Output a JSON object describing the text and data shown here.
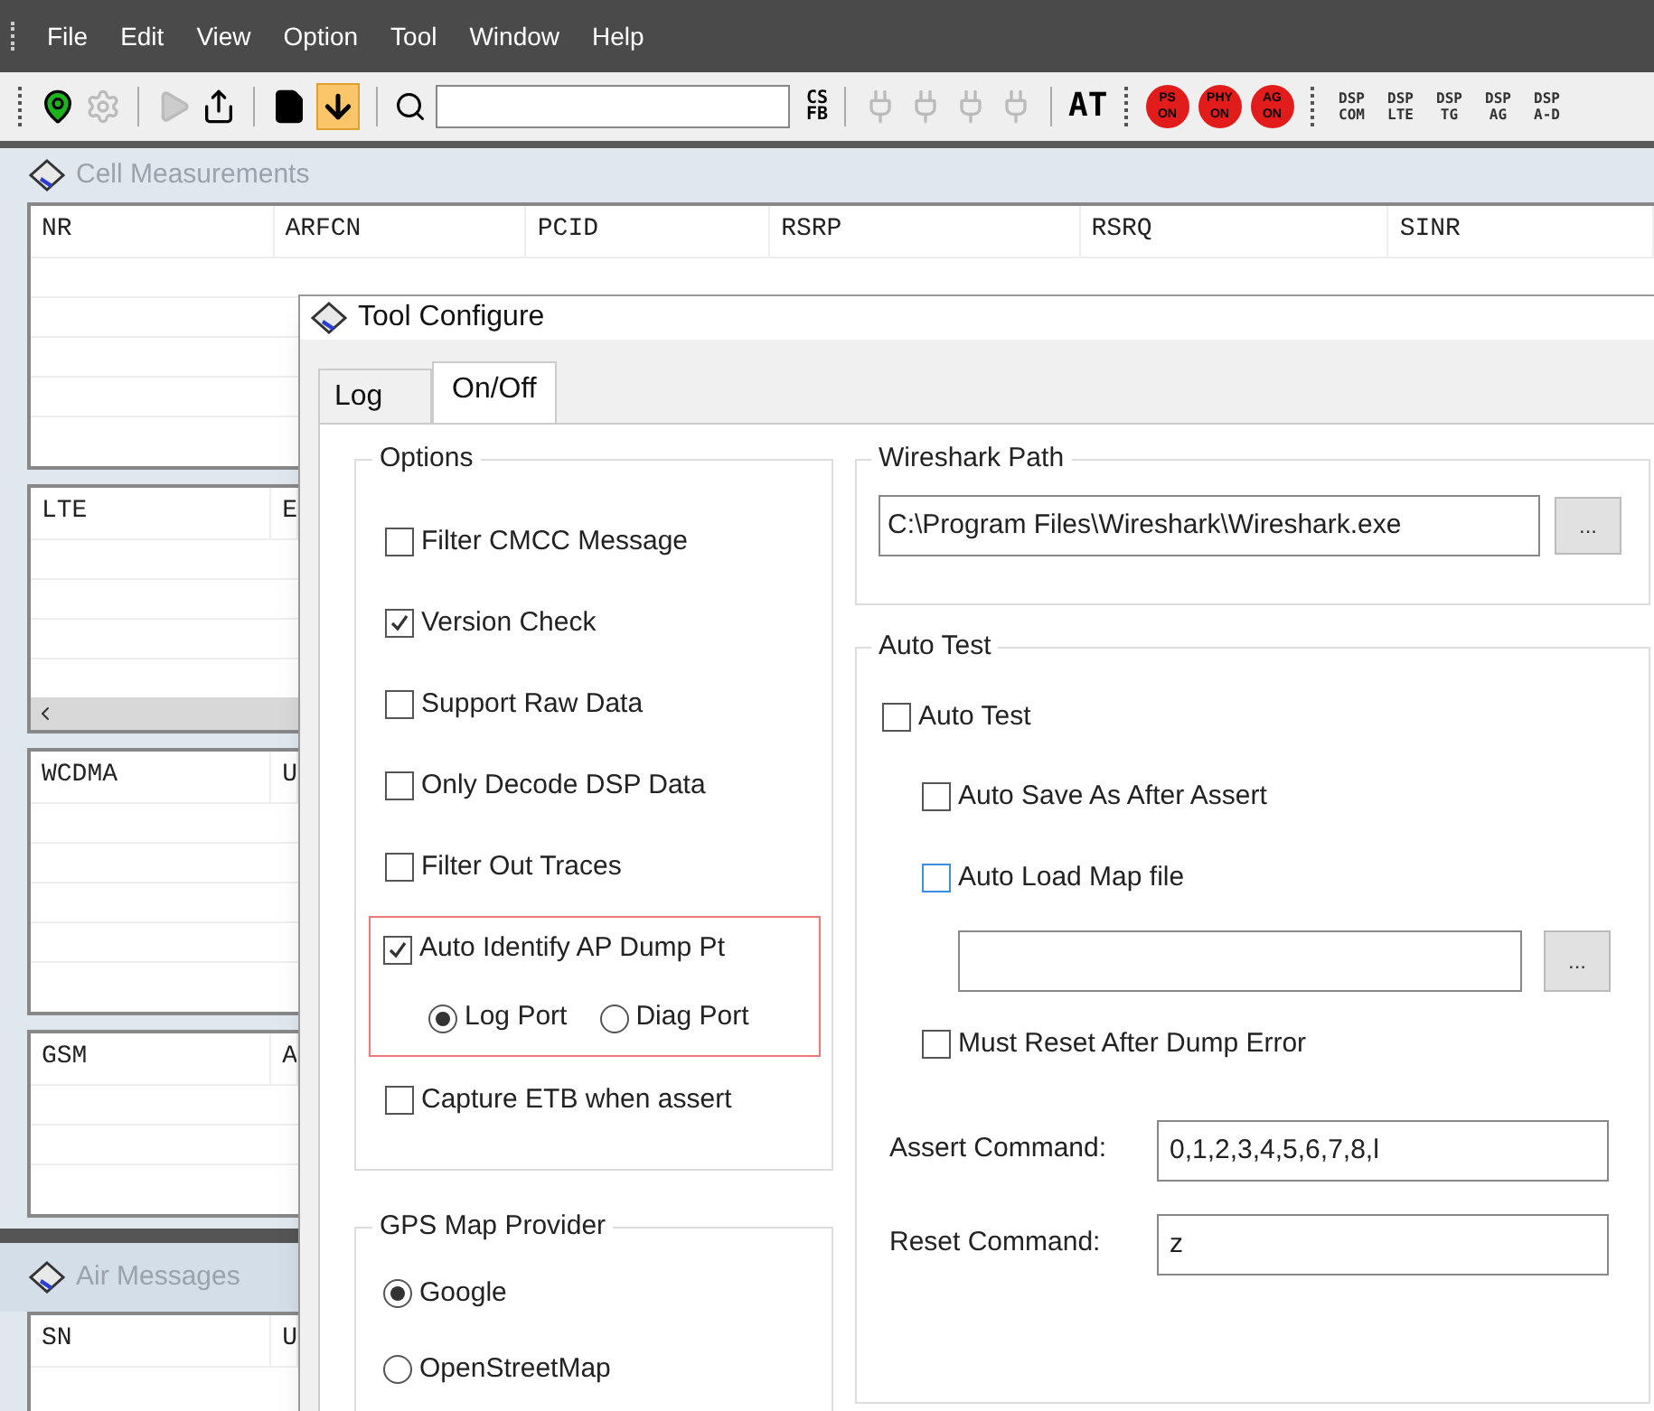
{
  "menu_bar": [
    "File",
    "Edit",
    "View",
    "Option",
    "Tool",
    "Window",
    "Help"
  ],
  "toolbar": {
    "download_pressed": true,
    "text_buttons": [
      {
        "kind": "cs",
        "lines": [
          "CS",
          "FB"
        ]
      },
      {
        "kind": "at",
        "lines": [
          "AT"
        ]
      }
    ],
    "status_buttons": [
      {
        "lines": [
          "PS",
          "ON"
        ]
      },
      {
        "lines": [
          "PHY",
          "ON"
        ]
      },
      {
        "lines": [
          "AG",
          "ON"
        ]
      }
    ],
    "dsp_buttons": [
      {
        "lines": [
          "DSP",
          "COM"
        ]
      },
      {
        "lines": [
          "DSP",
          "LTE"
        ]
      },
      {
        "lines": [
          "DSP",
          "TG"
        ]
      },
      {
        "lines": [
          "DSP",
          "AG"
        ]
      },
      {
        "lines": [
          "DSP",
          "A-D"
        ]
      }
    ]
  },
  "cell_panel": {
    "title": "Cell Measurements",
    "tables": [
      {
        "columns": [
          "NR",
          "ARFCN",
          "PCID",
          "RSRP",
          "RSRQ",
          "SINR"
        ],
        "scrollbar": false
      },
      {
        "columns": [
          "LTE",
          "E"
        ],
        "scrollbar": true
      },
      {
        "columns": [
          "WCDMA",
          "U"
        ],
        "scrollbar": false
      },
      {
        "columns": [
          "GSM",
          "A"
        ],
        "scrollbar": false
      }
    ]
  },
  "air_panel": {
    "title": "Air Messages",
    "columns": [
      "SN",
      "U"
    ]
  },
  "dialog": {
    "title": "Tool Configure",
    "tabs": [
      {
        "label": "Log",
        "selected": false
      },
      {
        "label": "On/Off",
        "selected": true
      }
    ],
    "options": {
      "title": "Options",
      "items": [
        {
          "label": "Filter CMCC Message",
          "checked": false,
          "highlighted": false
        },
        {
          "label": "Version Check",
          "checked": true,
          "highlighted": false
        },
        {
          "label": "Support Raw Data",
          "checked": false,
          "highlighted": false
        },
        {
          "label": "Only Decode DSP Data",
          "checked": false,
          "highlighted": false
        },
        {
          "label": "Filter Out Traces",
          "checked": false,
          "highlighted": false
        },
        {
          "label": "Auto Identify AP Dump Pt",
          "checked": true,
          "highlighted": true,
          "ports": [
            {
              "label": "Log Port",
              "selected": true
            },
            {
              "label": "Diag Port",
              "selected": false
            }
          ]
        },
        {
          "label": "Capture ETB when assert",
          "checked": false,
          "highlighted": false
        }
      ]
    },
    "gps": {
      "title": "GPS Map Provider",
      "providers": [
        {
          "label": "Google",
          "selected": true
        },
        {
          "label": "OpenStreetMap",
          "selected": false
        }
      ]
    },
    "wireshark": {
      "title": "Wireshark Path",
      "value": "C:\\Program Files\\Wireshark\\Wireshark.exe",
      "browse": "..."
    },
    "auto_test": {
      "title": "Auto Test",
      "item": {
        "label": "Auto Test",
        "checked": false,
        "children": [
          {
            "kind": "checkbox",
            "label": "Auto Save As After Assert",
            "checked": false,
            "focused": false
          },
          {
            "kind": "checkbox",
            "label": "Auto Load Map file",
            "checked": false,
            "focused": true
          },
          {
            "kind": "file_field",
            "browse": "..."
          },
          {
            "kind": "checkbox",
            "label": "Must Reset After Dump Error",
            "checked": false,
            "focused": false
          }
        ]
      },
      "commands": [
        {
          "label": "Assert Command:",
          "value": "0,1,2,3,4,5,6,7,8,l"
        },
        {
          "label": "Reset Command:",
          "value": "z"
        }
      ]
    }
  }
}
